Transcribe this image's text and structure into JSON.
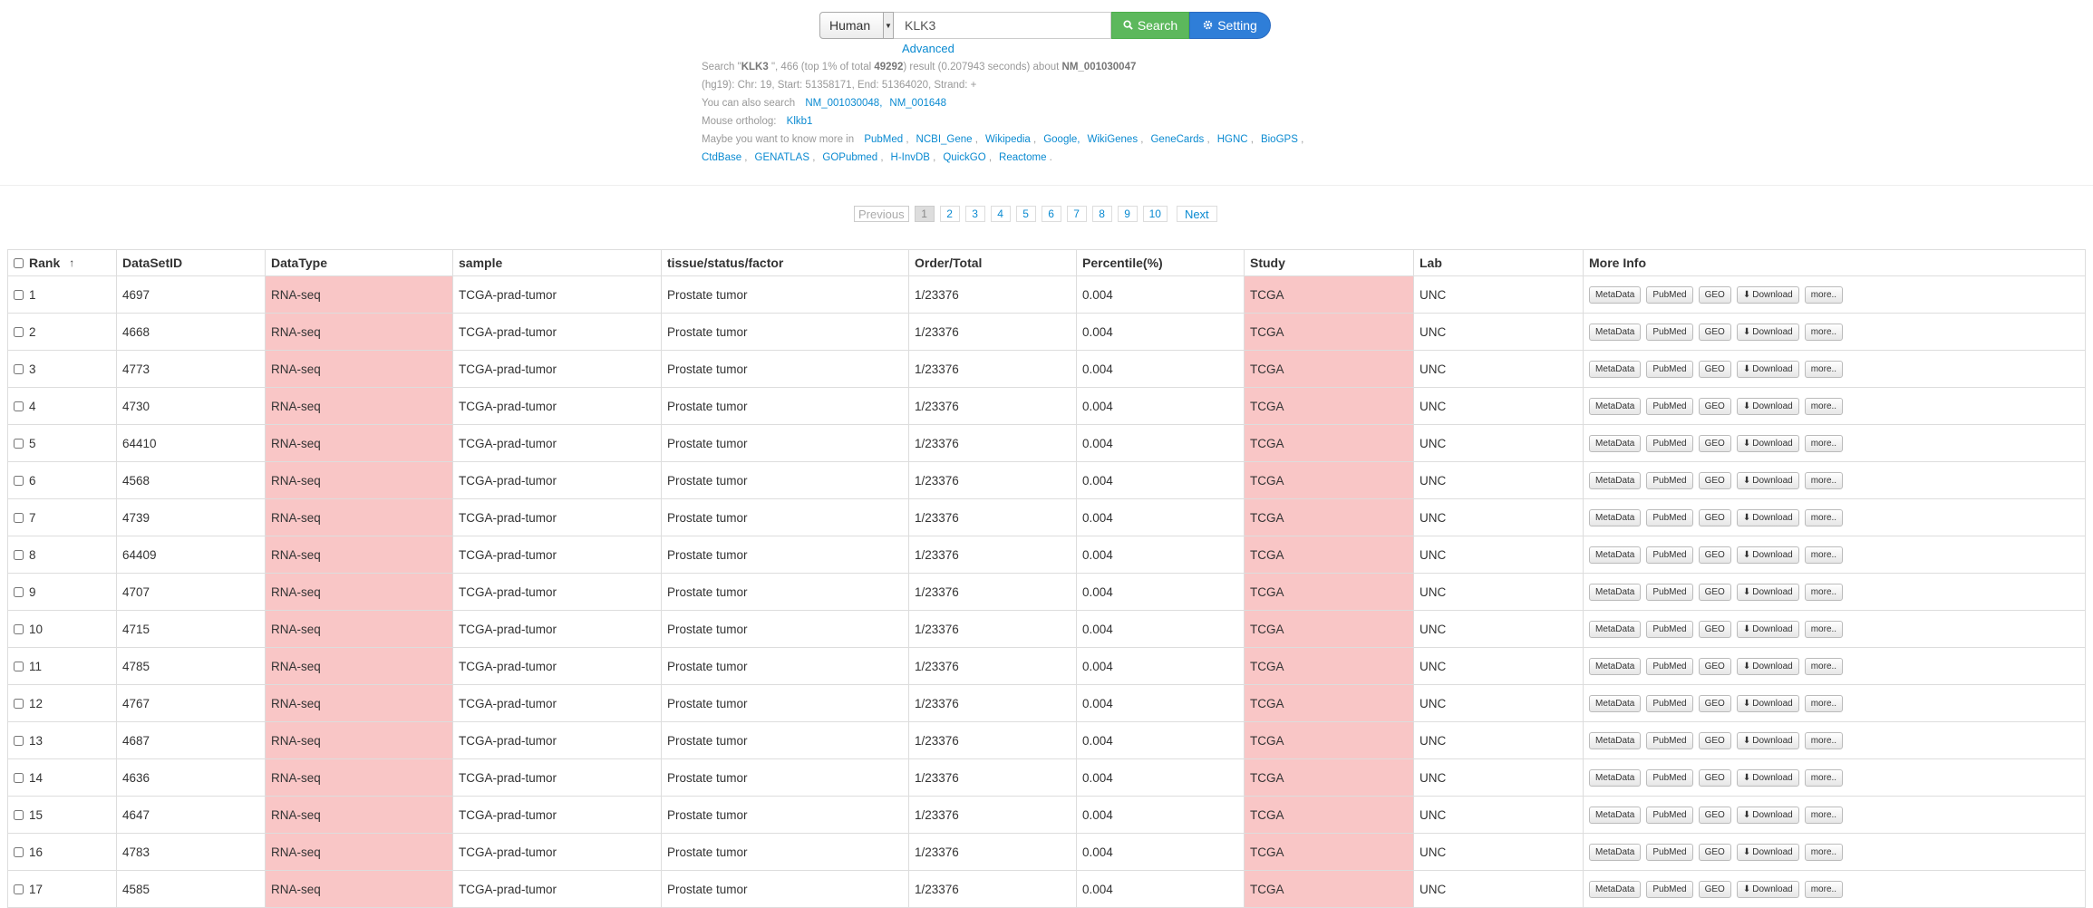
{
  "search": {
    "species": "Human",
    "gene_value": "KLK3",
    "search_label": "Search",
    "setting_label": "Setting",
    "advanced_label": "Advanced"
  },
  "info": {
    "summary": {
      "prefix": "Search \"",
      "gene": "KLK3",
      "mid1": " \", 466 (top 1% of total ",
      "total": "49292",
      "mid2": ") result (0.207943 seconds) about ",
      "refseq": "NM_001030047"
    },
    "coords": "(hg19): Chr: 19, Start: 51358171, End: 51364020, Strand: +",
    "also_search_label": "You can also search",
    "also_search": [
      "NM_001030048,",
      "NM_001648"
    ],
    "ortholog_label": "Mouse ortholog:",
    "ortholog": "Klkb1",
    "more_label": "Maybe you want to know more in",
    "more_links_line1": [
      "PubMed",
      "NCBI_Gene",
      "Wikipedia",
      "Google,",
      "WikiGenes",
      "GeneCards",
      "HGNC",
      "BioGPS"
    ],
    "more_links_line2": [
      "CtdBase",
      "GENATLAS",
      "GOPubmed",
      "H-InvDB",
      "QuickGO",
      "Reactome"
    ]
  },
  "pagination": {
    "previous": "Previous",
    "pages": [
      "1",
      "2",
      "3",
      "4",
      "5",
      "6",
      "7",
      "8",
      "9",
      "10"
    ],
    "active": "1",
    "next": "Next"
  },
  "table": {
    "headers": [
      "Rank",
      "DataSetID",
      "DataType",
      "sample",
      "tissue/status/factor",
      "Order/Total",
      "Percentile(%)",
      "Study",
      "Lab",
      "More Info"
    ],
    "buttons": [
      "MetaData",
      "PubMed",
      "GEO",
      "Download",
      "more.."
    ],
    "rows": [
      [
        "1",
        "4697",
        "RNA-seq",
        "TCGA-prad-tumor",
        "Prostate tumor",
        "1/23376",
        "0.004",
        "TCGA",
        "UNC"
      ],
      [
        "2",
        "4668",
        "RNA-seq",
        "TCGA-prad-tumor",
        "Prostate tumor",
        "1/23376",
        "0.004",
        "TCGA",
        "UNC"
      ],
      [
        "3",
        "4773",
        "RNA-seq",
        "TCGA-prad-tumor",
        "Prostate tumor",
        "1/23376",
        "0.004",
        "TCGA",
        "UNC"
      ],
      [
        "4",
        "4730",
        "RNA-seq",
        "TCGA-prad-tumor",
        "Prostate tumor",
        "1/23376",
        "0.004",
        "TCGA",
        "UNC"
      ],
      [
        "5",
        "64410",
        "RNA-seq",
        "TCGA-prad-tumor",
        "Prostate tumor",
        "1/23376",
        "0.004",
        "TCGA",
        "UNC"
      ],
      [
        "6",
        "4568",
        "RNA-seq",
        "TCGA-prad-tumor",
        "Prostate tumor",
        "1/23376",
        "0.004",
        "TCGA",
        "UNC"
      ],
      [
        "7",
        "4739",
        "RNA-seq",
        "TCGA-prad-tumor",
        "Prostate tumor",
        "1/23376",
        "0.004",
        "TCGA",
        "UNC"
      ],
      [
        "8",
        "64409",
        "RNA-seq",
        "TCGA-prad-tumor",
        "Prostate tumor",
        "1/23376",
        "0.004",
        "TCGA",
        "UNC"
      ],
      [
        "9",
        "4707",
        "RNA-seq",
        "TCGA-prad-tumor",
        "Prostate tumor",
        "1/23376",
        "0.004",
        "TCGA",
        "UNC"
      ],
      [
        "10",
        "4715",
        "RNA-seq",
        "TCGA-prad-tumor",
        "Prostate tumor",
        "1/23376",
        "0.004",
        "TCGA",
        "UNC"
      ],
      [
        "11",
        "4785",
        "RNA-seq",
        "TCGA-prad-tumor",
        "Prostate tumor",
        "1/23376",
        "0.004",
        "TCGA",
        "UNC"
      ],
      [
        "12",
        "4767",
        "RNA-seq",
        "TCGA-prad-tumor",
        "Prostate tumor",
        "1/23376",
        "0.004",
        "TCGA",
        "UNC"
      ],
      [
        "13",
        "4687",
        "RNA-seq",
        "TCGA-prad-tumor",
        "Prostate tumor",
        "1/23376",
        "0.004",
        "TCGA",
        "UNC"
      ],
      [
        "14",
        "4636",
        "RNA-seq",
        "TCGA-prad-tumor",
        "Prostate tumor",
        "1/23376",
        "0.004",
        "TCGA",
        "UNC"
      ],
      [
        "15",
        "4647",
        "RNA-seq",
        "TCGA-prad-tumor",
        "Prostate tumor",
        "1/23376",
        "0.004",
        "TCGA",
        "UNC"
      ],
      [
        "16",
        "4783",
        "RNA-seq",
        "TCGA-prad-tumor",
        "Prostate tumor",
        "1/23376",
        "0.004",
        "TCGA",
        "UNC"
      ],
      [
        "17",
        "4585",
        "RNA-seq",
        "TCGA-prad-tumor",
        "Prostate tumor",
        "1/23376",
        "0.004",
        "TCGA",
        "UNC"
      ]
    ]
  },
  "colors": {
    "highlight": "#f9c6c6",
    "link": "#0a8ad1",
    "search_green": "#5cb85c",
    "setting_blue": "#2f7ed8"
  },
  "icons": {
    "search": "search-icon",
    "setting": "gear-icon",
    "sort": "sort-up-icon",
    "download": "download-icon"
  }
}
